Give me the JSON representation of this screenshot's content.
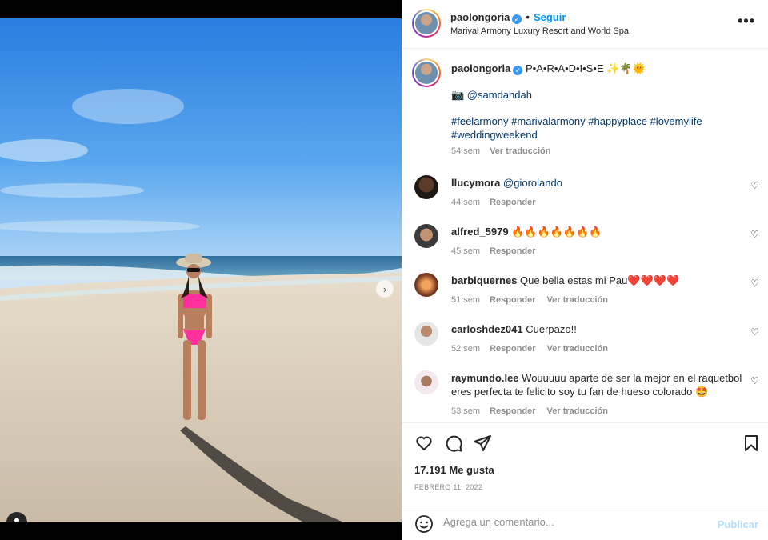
{
  "post": {
    "username": "paolongoria",
    "follow_label": "Seguir",
    "location": "Marival Armony Luxury Resort and World Spa",
    "caption": "P•A•R•A•D•I•S•E ✨🌴🌞",
    "photo_credit": "📷 @samdahdah",
    "hashtags": "#feelarmony #marivalarmony #happyplace #lovemylife #weddingweekend",
    "caption_time": "54 sem",
    "translate_label": "Ver traducción"
  },
  "comments": [
    {
      "user": "llucymora",
      "text": "@giorolando",
      "time": "44 sem",
      "reply": "Responder",
      "translate": ""
    },
    {
      "user": "alfred_5979",
      "text": "🔥🔥🔥🔥🔥🔥🔥",
      "time": "45 sem",
      "reply": "Responder",
      "translate": ""
    },
    {
      "user": "barbiquernes",
      "text": "Que bella estas mi Pau❤️❤️❤️❤️",
      "time": "51 sem",
      "reply": "Responder",
      "translate": "Ver traducción"
    },
    {
      "user": "carloshdez041",
      "text": "Cuerpazo!!",
      "time": "52 sem",
      "reply": "Responder",
      "translate": "Ver traducción"
    },
    {
      "user": "raymundo.lee",
      "text": "Wouuuuu aparte de ser la mejor en el raquetbol eres perfecta te felicito soy tu fan de hueso colorado 🤩",
      "time": "53 sem",
      "reply": "Responder",
      "translate": "Ver traducción"
    }
  ],
  "likes": "17.191 Me gusta",
  "date": "FEBRERO 11, 2022",
  "add_comment": {
    "placeholder": "Agrega un comentario...",
    "publish_label": "Publicar"
  },
  "icons": [
    "heart-icon",
    "comment-icon",
    "share-icon",
    "bookmark-icon",
    "emoji-icon",
    "more-icon",
    "chevron-right-icon",
    "user-tag-icon",
    "verified-icon"
  ],
  "colors": {
    "accent": "#0095f6",
    "link": "#00376b",
    "muted": "#8e8e8e",
    "publish_disabled": "#b2dffc"
  }
}
